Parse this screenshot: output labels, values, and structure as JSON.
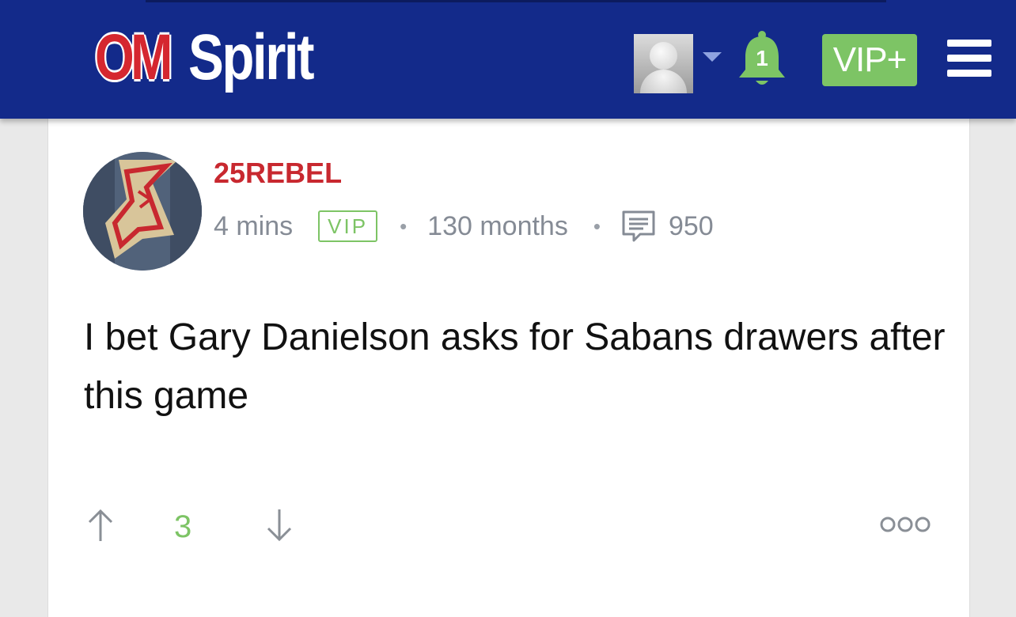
{
  "header": {
    "logo_om": "OM",
    "logo_spirit": "Spirit",
    "notification_count": "1",
    "vip_plus_label": "VIP+",
    "icons": [
      "user-avatar",
      "chevron-down-icon",
      "bell-icon",
      "menu-icon"
    ]
  },
  "post": {
    "username": "25REBEL",
    "time": "4 mins",
    "badge": "VIP",
    "membership": "130 months",
    "post_count": "950",
    "text": "I bet Gary Danielson asks for Sabans drawers after this game",
    "votes": "3",
    "icons": [
      "arrow-up-icon",
      "arrow-down-icon",
      "comment-icon",
      "more-icon"
    ]
  },
  "colors": {
    "header_bg": "#132a8a",
    "brand_red": "#c8282f",
    "accent_green": "#7dc465",
    "meta_gray": "#858b95"
  }
}
